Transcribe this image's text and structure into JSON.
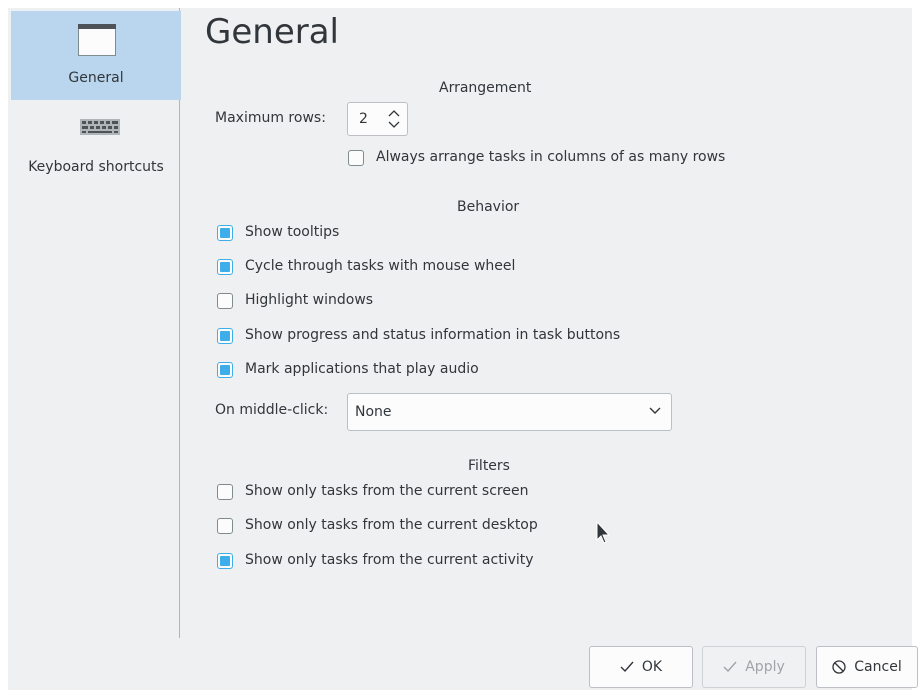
{
  "sidebar": {
    "items": [
      {
        "label": "General",
        "icon": "window-icon",
        "selected": true
      },
      {
        "label": "Keyboard shortcuts",
        "icon": "keyboard-icon",
        "selected": false
      }
    ]
  },
  "page_title": "General",
  "arrangement": {
    "title": "Arrangement",
    "max_rows_label": "Maximum rows:",
    "max_rows_value": "2",
    "columns_checkbox": {
      "label": "Always arrange tasks in columns of as many rows",
      "checked": false
    }
  },
  "behavior": {
    "title": "Behavior",
    "options": [
      {
        "label": "Show tooltips",
        "checked": true
      },
      {
        "label": "Cycle through tasks with mouse wheel",
        "checked": true
      },
      {
        "label": "Highlight windows",
        "checked": false
      },
      {
        "label": "Show progress and status information in task buttons",
        "checked": true
      },
      {
        "label": "Mark applications that play audio",
        "checked": true
      }
    ],
    "middle_click_label": "On middle-click:",
    "middle_click_value": "None"
  },
  "filters": {
    "title": "Filters",
    "options": [
      {
        "label": "Show only tasks from the current screen",
        "checked": false
      },
      {
        "label": "Show only tasks from the current desktop",
        "checked": false
      },
      {
        "label": "Show only tasks from the current activity",
        "checked": true
      }
    ]
  },
  "buttons": {
    "ok": "OK",
    "apply": "Apply",
    "cancel": "Cancel"
  },
  "colors": {
    "accent": "#3daee9",
    "selection": "#b9d6ee",
    "background": "#eff0f1"
  }
}
